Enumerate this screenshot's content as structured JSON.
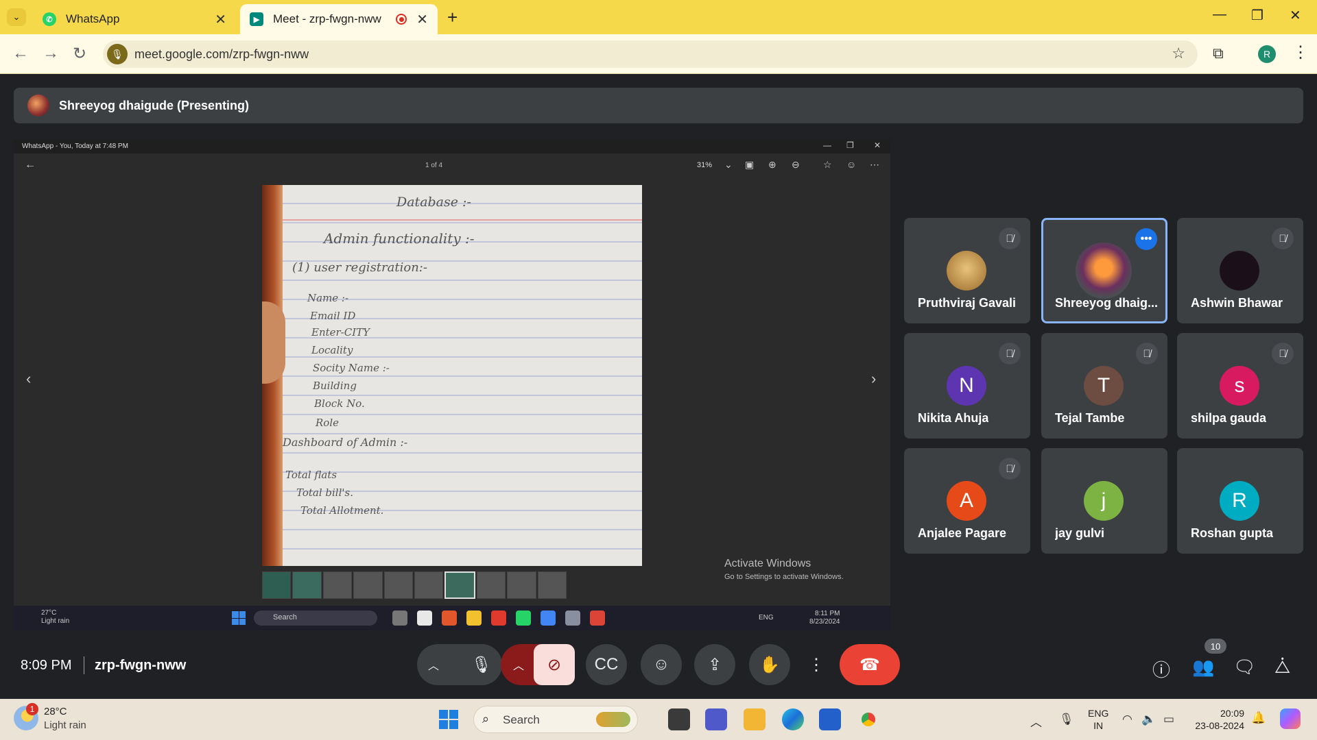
{
  "browser": {
    "tabs": [
      {
        "title": "WhatsApp",
        "favicon_color": "#25d366"
      },
      {
        "title": "Meet - zrp-fwgn-nww",
        "favicon_color": "#00897b"
      }
    ],
    "url": "meet.google.com/zrp-fwgn-nww",
    "profile_initial": "R"
  },
  "presenting": {
    "label": "Shreeyog dhaigude (Presenting)"
  },
  "shared_screen": {
    "window_title": "WhatsApp - You, Today at 7:48 PM",
    "page_indicator": "1 of 4",
    "zoom": "31%",
    "handwritten_note": {
      "heading": "Database :-",
      "section": "Admin functionality :-",
      "subsection": "(1) user registration:-",
      "fields": [
        "Name :-",
        "Email ID",
        "Enter-CITY",
        "Locality",
        "Socity Name :-",
        "Building",
        "Block No.",
        "Role"
      ],
      "dashboard": "Dashboard of Admin :-",
      "dashboard_items": [
        "Total flats",
        "Total bill's.",
        "Total Allotment."
      ]
    },
    "watermark": {
      "line1": "Activate Windows",
      "line2": "Go to Settings to activate Windows."
    },
    "taskbar": {
      "temp": "27°C",
      "condition": "Light rain",
      "search": "Search",
      "lang": "ENG",
      "time": "8:11 PM",
      "date": "8/23/2024"
    }
  },
  "participants": [
    {
      "name": "Pruthviraj Gavali",
      "initial": "",
      "color": "#c8a46a",
      "muted": true,
      "highlighted": false
    },
    {
      "name": "Shreeyog dhaig...",
      "initial": "",
      "color": "#5a3b3b",
      "muted": false,
      "highlighted": true
    },
    {
      "name": "Ashwin Bhawar",
      "initial": "",
      "color": "#1b0f1a",
      "muted": true,
      "highlighted": false
    },
    {
      "name": "Nikita Ahuja",
      "initial": "N",
      "color": "#5e35b1",
      "muted": true,
      "highlighted": false
    },
    {
      "name": "Tejal Tambe",
      "initial": "T",
      "color": "#6d4c41",
      "muted": true,
      "highlighted": false
    },
    {
      "name": "shilpa gauda",
      "initial": "s",
      "color": "#d81b60",
      "muted": true,
      "highlighted": false
    },
    {
      "name": "Anjalee Pagare",
      "initial": "A",
      "color": "#e64a19",
      "muted": true,
      "highlighted": false
    },
    {
      "name": "jay gulvi",
      "initial": "j",
      "color": "#7cb342",
      "muted": false,
      "highlighted": false
    },
    {
      "name": "Roshan gupta",
      "initial": "R",
      "color": "#00acc1",
      "muted": false,
      "highlighted": false
    }
  ],
  "meeting": {
    "time": "8:09 PM",
    "code": "zrp-fwgn-nww",
    "participant_count": "10"
  },
  "windows_taskbar": {
    "weather_badge": "1",
    "temp": "28°C",
    "condition": "Light rain",
    "search": "Search",
    "lang_line1": "ENG",
    "lang_line2": "IN",
    "time": "20:09",
    "date": "23-08-2024"
  }
}
